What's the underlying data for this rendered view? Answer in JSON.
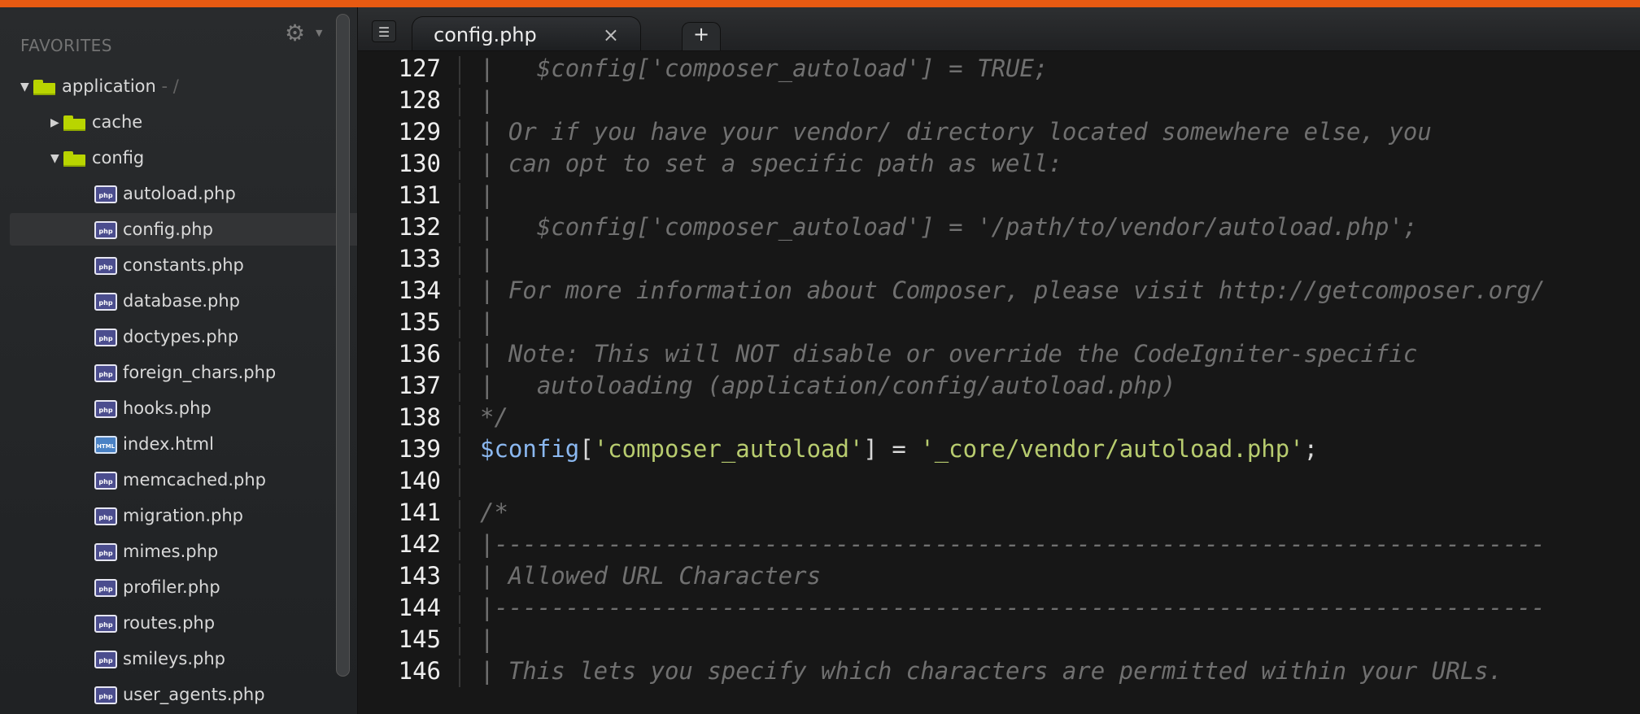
{
  "sidebar": {
    "header": "FAVORITES",
    "gear_icon": "gear-icon",
    "tree": [
      {
        "label": "application",
        "suffix": " - /",
        "type": "folder-open",
        "depth": 0
      },
      {
        "label": "cache",
        "suffix": "",
        "type": "folder-closed",
        "depth": 1
      },
      {
        "label": "config",
        "suffix": "",
        "type": "folder-open",
        "depth": 1
      },
      {
        "label": "autoload.php",
        "suffix": "",
        "type": "php",
        "depth": 2
      },
      {
        "label": "config.php",
        "suffix": "",
        "type": "php",
        "depth": 2,
        "selected": true
      },
      {
        "label": "constants.php",
        "suffix": "",
        "type": "php",
        "depth": 2
      },
      {
        "label": "database.php",
        "suffix": "",
        "type": "php",
        "depth": 2
      },
      {
        "label": "doctypes.php",
        "suffix": "",
        "type": "php",
        "depth": 2
      },
      {
        "label": "foreign_chars.php",
        "suffix": "",
        "type": "php",
        "depth": 2
      },
      {
        "label": "hooks.php",
        "suffix": "",
        "type": "php",
        "depth": 2
      },
      {
        "label": "index.html",
        "suffix": "",
        "type": "html",
        "depth": 2
      },
      {
        "label": "memcached.php",
        "suffix": "",
        "type": "php",
        "depth": 2
      },
      {
        "label": "migration.php",
        "suffix": "",
        "type": "php",
        "depth": 2
      },
      {
        "label": "mimes.php",
        "suffix": "",
        "type": "php",
        "depth": 2
      },
      {
        "label": "profiler.php",
        "suffix": "",
        "type": "php",
        "depth": 2
      },
      {
        "label": "routes.php",
        "suffix": "",
        "type": "php",
        "depth": 2
      },
      {
        "label": "smileys.php",
        "suffix": "",
        "type": "php",
        "depth": 2
      },
      {
        "label": "user_agents.php",
        "suffix": "",
        "type": "php",
        "depth": 2
      }
    ]
  },
  "tabs": {
    "panel_icon": "panel-toggle-icon",
    "active_tab": "config.php",
    "close_glyph": "×",
    "new_tab_glyph": "+"
  },
  "editor": {
    "lines": [
      {
        "number": "127",
        "text": "|   $config['composer_autoload'] = TRUE;"
      },
      {
        "number": "128",
        "text": "|"
      },
      {
        "number": "129",
        "text": "| Or if you have your vendor/ directory located somewhere else, you"
      },
      {
        "number": "130",
        "text": "| can opt to set a specific path as well:"
      },
      {
        "number": "131",
        "text": "|"
      },
      {
        "number": "132",
        "text": "|   $config['composer_autoload'] = '/path/to/vendor/autoload.php';"
      },
      {
        "number": "133",
        "text": "|"
      },
      {
        "number": "134",
        "text": "| For more information about Composer, please visit http://getcomposer.org/"
      },
      {
        "number": "135",
        "text": "|"
      },
      {
        "number": "136",
        "text": "| Note: This will NOT disable or override the CodeIgniter-specific"
      },
      {
        "number": "137",
        "text": "|   autoloading (application/config/autoload.php)"
      },
      {
        "number": "138",
        "text": "*/"
      },
      {
        "number": "139",
        "code": {
          "variable": "$config",
          "open_bracket": "[",
          "key": "'composer_autoload'",
          "assignment": "] = ",
          "value": "'_core/vendor/autoload.php'",
          "end": ";"
        }
      },
      {
        "number": "140",
        "text": ""
      },
      {
        "number": "141",
        "text": "/*"
      },
      {
        "number": "142",
        "text": "|--------------------------------------------------------------------------"
      },
      {
        "number": "143",
        "text": "| Allowed URL Characters"
      },
      {
        "number": "144",
        "text": "|--------------------------------------------------------------------------"
      },
      {
        "number": "145",
        "text": "|"
      },
      {
        "number": "146",
        "text": "| This lets you specify which characters are permitted within your URLs."
      }
    ]
  },
  "colors": {
    "window_accent": "#e75a12",
    "sidebar_background": "#25272a",
    "editor_background": "#171717",
    "folder": "#b9d500",
    "php_icon": "#4b4d8e",
    "html_icon": "#4a82c5",
    "comment": "#707070",
    "variable": "#8bb8f0",
    "string": "#b8cc6f"
  }
}
